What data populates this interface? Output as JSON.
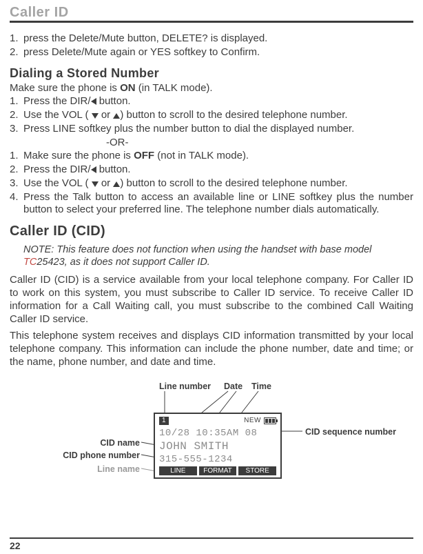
{
  "header": {
    "title": "Caller ID"
  },
  "intro": {
    "l1_num": "1.",
    "l1": "press the Delete/Mute button, DELETE? is displayed.",
    "l2_num": "2.",
    "l2": "press Delete/Mute again or YES softkey to Confirm."
  },
  "dialing": {
    "heading": "Dialing a Stored Number",
    "lead_a": "Make sure the phone is ",
    "on": "ON",
    "lead_b": " (in TALK mode).",
    "l1_num": "1.",
    "l1_a": "Press the DIR/",
    "l1_b": "button.",
    "l2_num": "2.",
    "l2_a": "Use the VOL (",
    "l2_mid": " or ",
    "l2_b": ") button to scroll to the desired telephone number.",
    "l3_num": "3.",
    "l3": "Press LINE softkey plus the number button to dial the displayed number.",
    "or": "-OR-",
    "b1_num": "1.",
    "b1_a": "Make sure the phone is ",
    "off": "OFF",
    "b1_b": " (not in TALK mode).",
    "b2_num": "2.",
    "b2_a": "Press the DIR/",
    "b2_b": " button.",
    "b3_num": "3.",
    "b3_a": "Use the VOL (",
    "b3_mid": " or ",
    "b3_b": ") button to scroll to the desired telephone number.",
    "b4_num": "4.",
    "b4": "Press the Talk button to access an available line or LINE softkey plus the number button to select your preferred line. The telephone number dials automatically."
  },
  "cid": {
    "heading": "Caller ID (CID)",
    "note_a": "NOTE: This feature does not function when using the handset with base model ",
    "note_tc": "TC",
    "note_b": "25423, as it does not support Caller ID.",
    "p1": "Caller ID (CID) is a service available from your local telephone company. For Caller ID to work on this system, you must subscribe to Caller ID service. To receive Caller ID information for a Call Waiting call, you must subscribe to the combined Call Waiting Caller ID service.",
    "p2": "This telephone system receives and displays CID information transmitted by your local telephone company. This information can include the phone number, date and time; or the name, phone number, and date and time."
  },
  "diagram": {
    "labels": {
      "line_number": "Line number",
      "date": "Date",
      "time": "Time",
      "cid_name": "CID name",
      "cid_phone_number": "CID phone number",
      "line_name": "Line name",
      "cid_sequence_number": "CID sequence number"
    },
    "lcd": {
      "line_indicator": "1",
      "new": "NEW",
      "row1": "10/28 10:35AM 08",
      "row2": "JOHN SMITH",
      "row3": "315-555-1234",
      "soft1": "LINE",
      "soft2": "FORMAT",
      "soft3": "STORE"
    }
  },
  "footer": {
    "page": "22"
  }
}
